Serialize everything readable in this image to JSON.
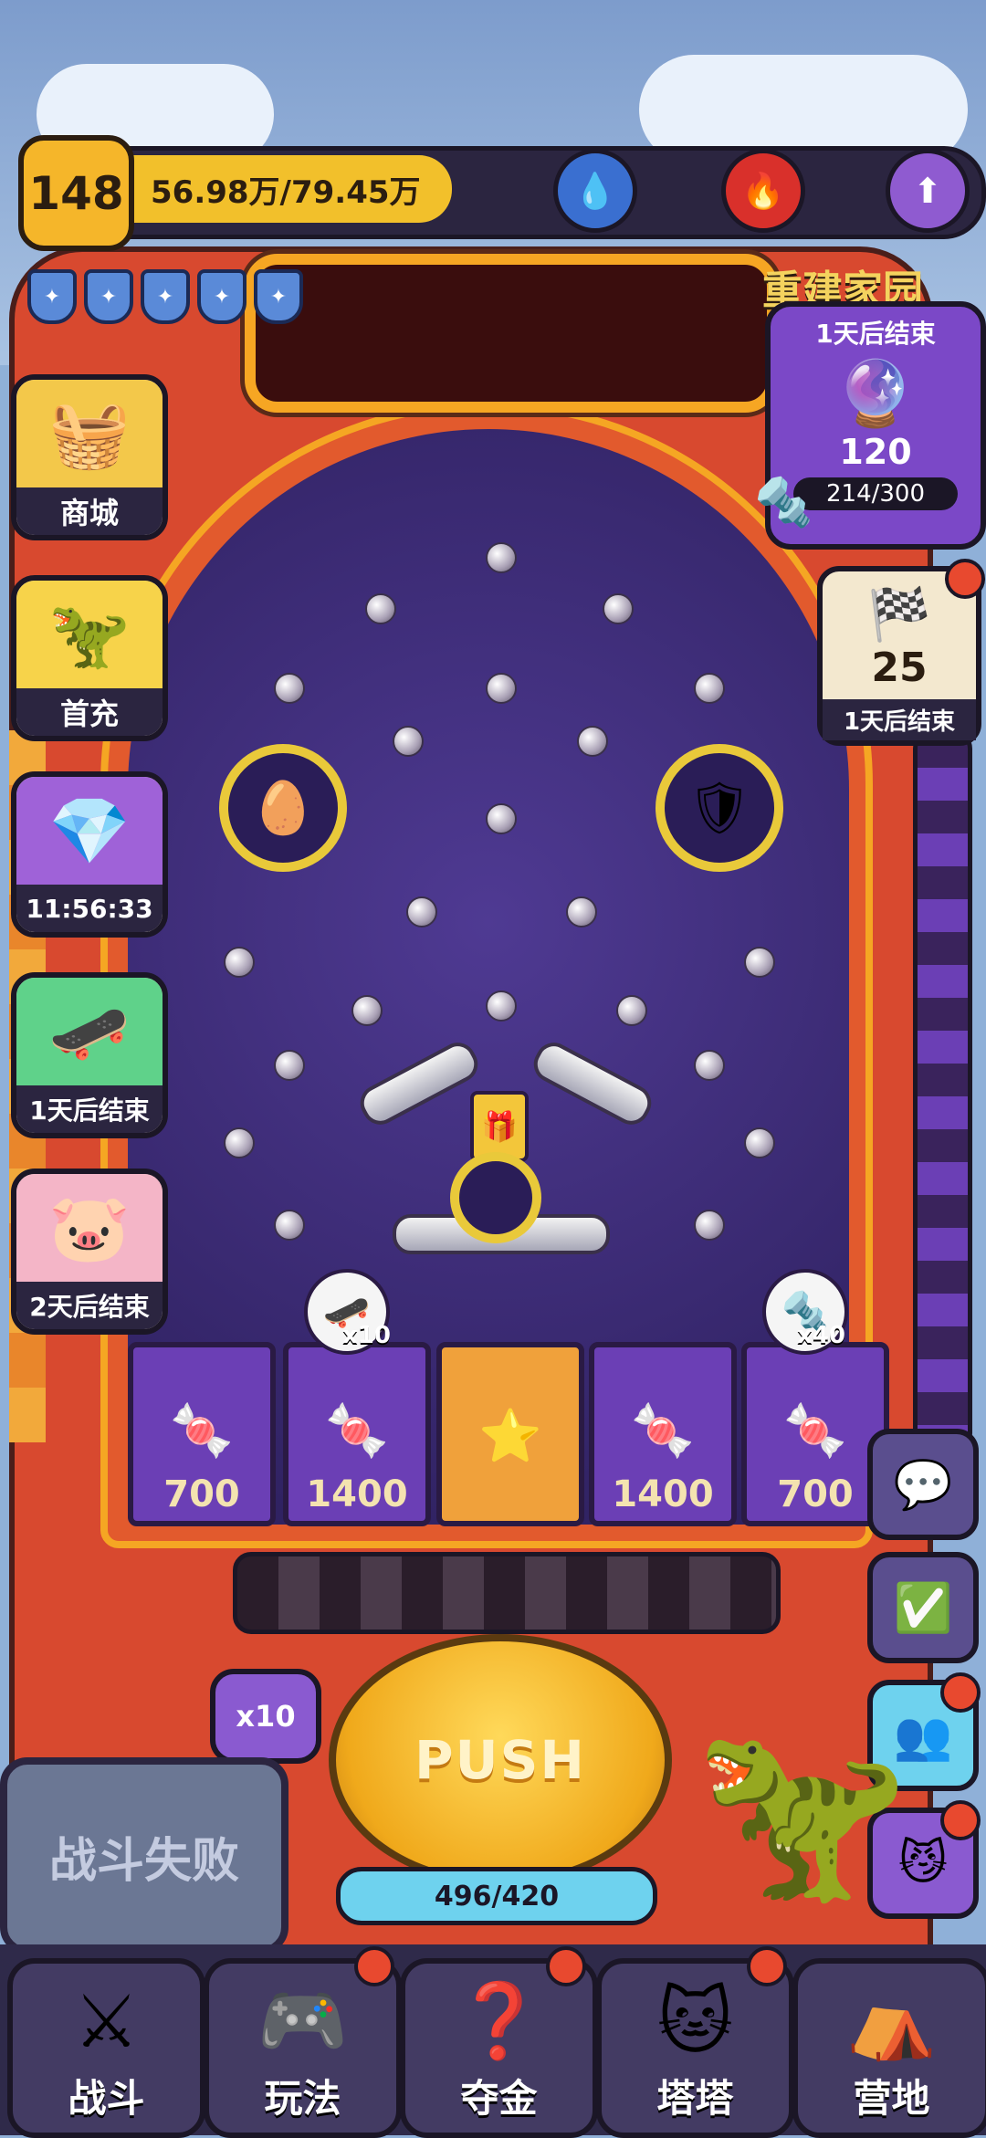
{
  "top_bar": {
    "level": "148",
    "experience": "56.98万/79.45万",
    "boosts": [
      {
        "icon": "water-drop-up-icon",
        "color": "#3a6fd0"
      },
      {
        "icon": "flame-up-icon",
        "color": "#d9302b"
      },
      {
        "icon": "arrow-up-icon",
        "color": "#8f5bd0"
      }
    ]
  },
  "shields": {
    "count": 5,
    "icon": "shield-icon"
  },
  "left_menu": [
    {
      "label": "商城",
      "icon": "basket-icon"
    },
    {
      "label": "首充",
      "icon": "dino-icon"
    },
    {
      "label": "11:56:33",
      "icon": "gem-bag-icon"
    },
    {
      "label": "1天后结束",
      "icon": "skateboard-icon"
    },
    {
      "label": "2天后结束",
      "icon": "piggy-bank-icon"
    }
  ],
  "event": {
    "title": "重建家园",
    "timer": "1天后结束",
    "count": "120",
    "progress_text": "214/300"
  },
  "race_event": {
    "count": "25",
    "timer": "1天后结束"
  },
  "slots": [
    {
      "value": "700",
      "icon": "candy-icon"
    },
    {
      "value": "1400",
      "icon": "candy-pile-icon"
    },
    {
      "value": "",
      "icon": "question-star-icon"
    },
    {
      "value": "1400",
      "icon": "candy-pile-icon"
    },
    {
      "value": "700",
      "icon": "candy-icon"
    }
  ],
  "slot_badges": [
    {
      "text": "x10",
      "icon": "skateboard-icon"
    },
    {
      "text": "x40",
      "icon": "screw-icon"
    }
  ],
  "right_buttons": [
    "chat-icon",
    "checklist-icon",
    "friends-icon",
    "cat-badge-icon"
  ],
  "multiplier": "x10",
  "push_label": "PUSH",
  "push_progress": "496/420",
  "battle_status": "战斗失败",
  "bottom_nav": [
    {
      "label": "战斗",
      "icon": "crossed-swords-icon"
    },
    {
      "label": "玩法",
      "icon": "gamepad-icon"
    },
    {
      "label": "夺金",
      "icon": "mystery-box-icon"
    },
    {
      "label": "塔塔",
      "icon": "cat-face-icon"
    },
    {
      "label": "营地",
      "icon": "tent-icon"
    }
  ]
}
